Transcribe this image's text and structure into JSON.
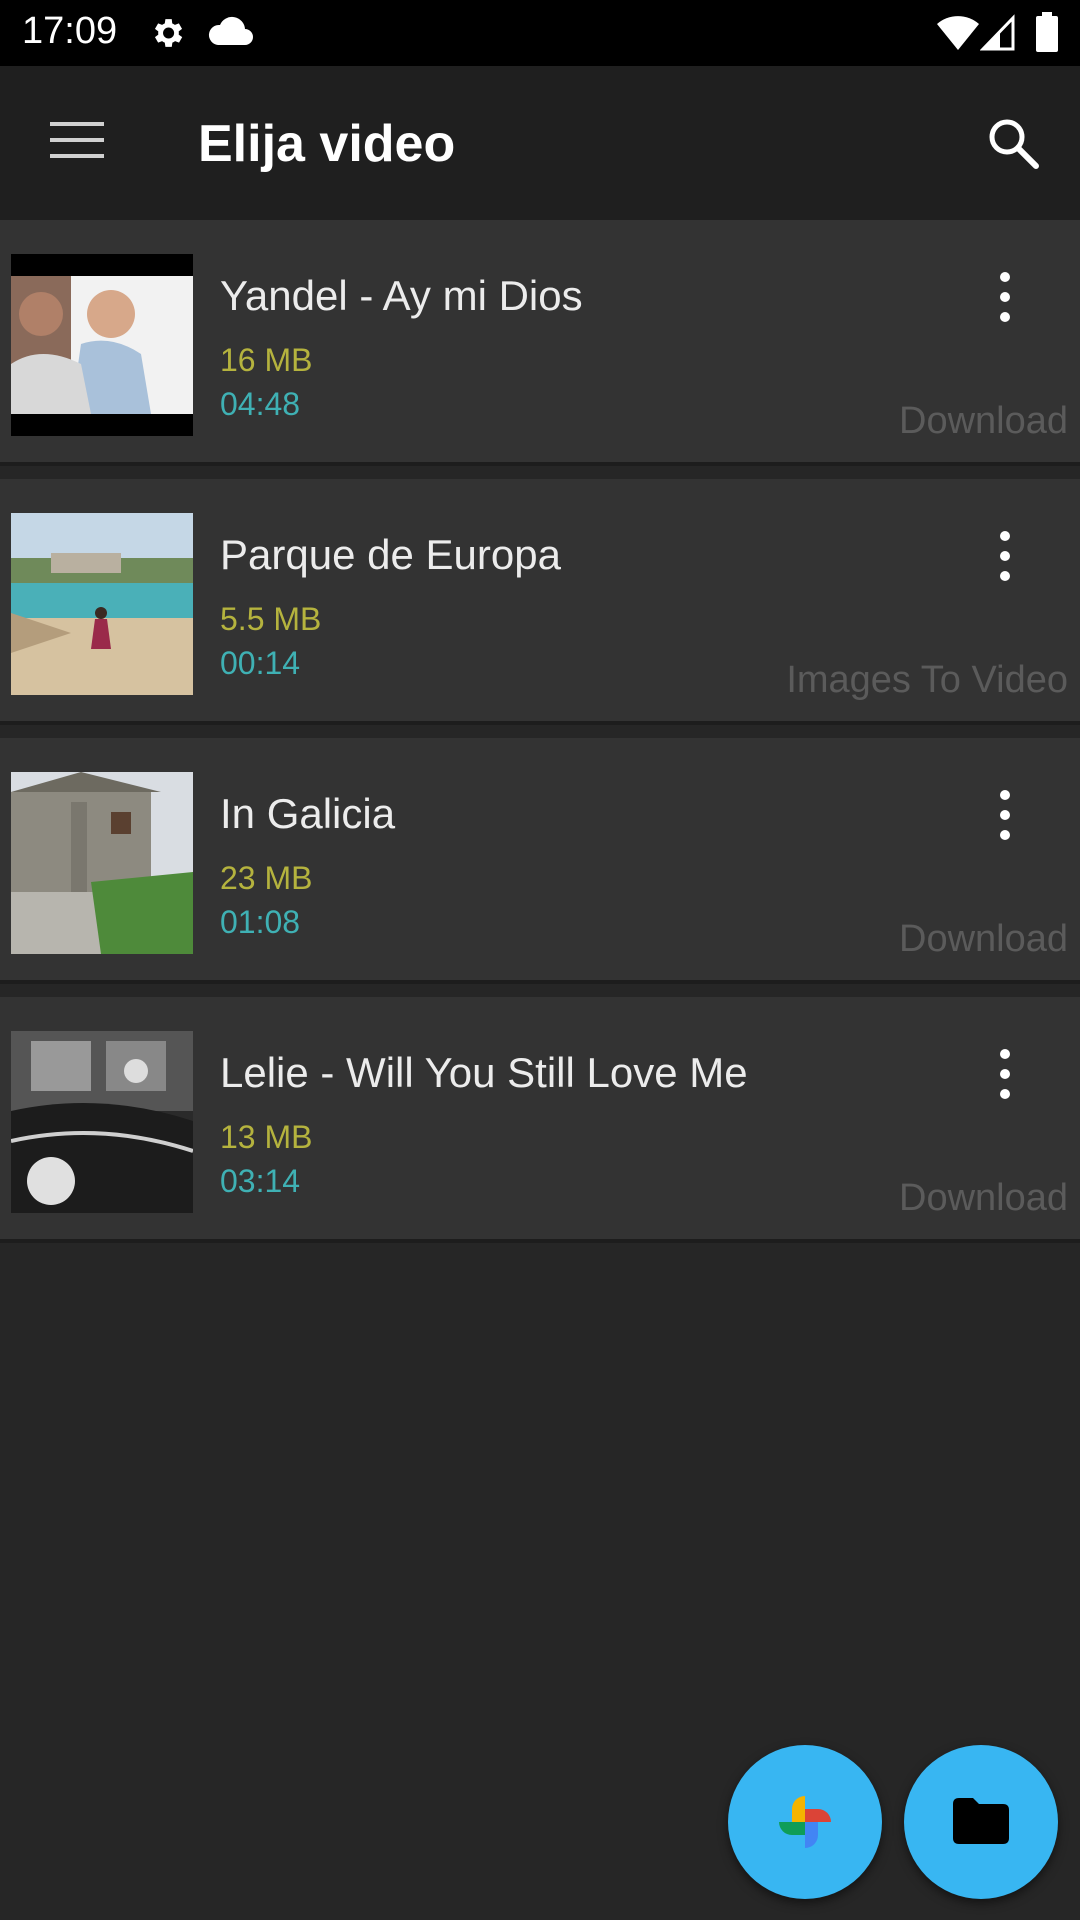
{
  "status_bar": {
    "time": "17:09"
  },
  "toolbar": {
    "title": "Elija video"
  },
  "videos": [
    {
      "title": "Yandel - Ay mi Dios",
      "size": "16 MB",
      "duration": "04:48",
      "source": "Download"
    },
    {
      "title": "Parque de Europa",
      "size": "5.5 MB",
      "duration": "00:14",
      "source": "Images To Video"
    },
    {
      "title": "In Galicia",
      "size": "23 MB",
      "duration": "01:08",
      "source": "Download"
    },
    {
      "title": "Lelie - Will You Still Love Me",
      "size": "13 MB",
      "duration": "03:14",
      "source": "Download"
    }
  ],
  "colors": {
    "background": "#262626",
    "card": "#333333",
    "toolbar": "#1f1f1f",
    "size_text": "#b5b33e",
    "duration_text": "#3fb1b4",
    "fab": "#38b6f2"
  },
  "icons": {
    "status": [
      "gear-icon",
      "cloud-icon",
      "wifi-icon",
      "signal-icon",
      "battery-icon"
    ],
    "toolbar": [
      "menu-icon",
      "search-icon"
    ],
    "fabs": [
      "google-photos-icon",
      "folder-icon"
    ]
  }
}
